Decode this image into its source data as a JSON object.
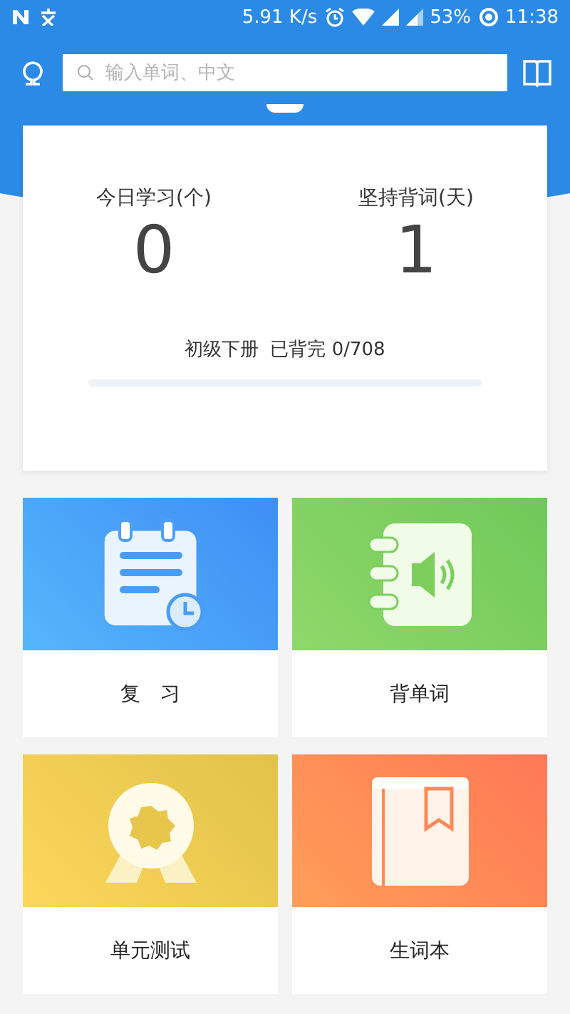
{
  "status_bar": {
    "speed": "5.91 K/s",
    "battery": "53%",
    "time": "11:38"
  },
  "search": {
    "placeholder": "输入单词、中文"
  },
  "stats": [
    {
      "label": "今日学习(个)",
      "value": "0"
    },
    {
      "label": "坚持背词(天)",
      "value": "1"
    }
  ],
  "progress": {
    "book": "初级下册",
    "status": "已背完 0/708",
    "level": 0
  },
  "tiles": [
    {
      "kind": "review",
      "label": "复　习"
    },
    {
      "kind": "memorize",
      "label": "背单词"
    },
    {
      "kind": "test",
      "label": "单元测试"
    },
    {
      "kind": "wordbook",
      "label": "生词本"
    }
  ]
}
